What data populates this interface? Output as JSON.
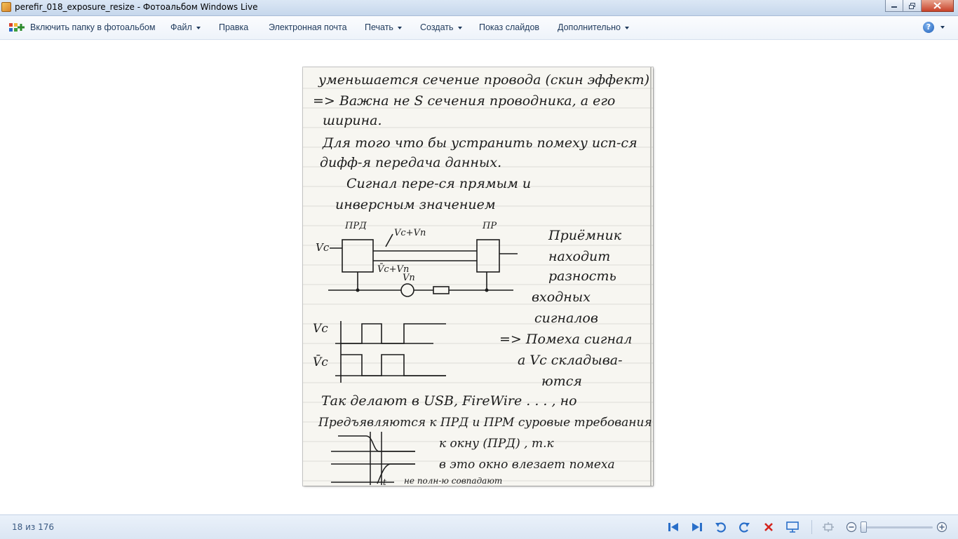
{
  "window": {
    "title": "perefir_018_exposure_resize - Фотоальбом Windows Live"
  },
  "menubar": {
    "items": [
      {
        "label": "Включить папку в фотоальбом",
        "has_dropdown": false
      },
      {
        "label": "Файл",
        "has_dropdown": true
      },
      {
        "label": "Правка",
        "has_dropdown": false
      },
      {
        "label": "Электронная почта",
        "has_dropdown": false
      },
      {
        "label": "Печать",
        "has_dropdown": true
      },
      {
        "label": "Создать",
        "has_dropdown": true
      },
      {
        "label": "Показ слайдов",
        "has_dropdown": false
      },
      {
        "label": "Дополнительно",
        "has_dropdown": true
      }
    ],
    "help_icon": "help-icon"
  },
  "photo": {
    "lines": [
      "уменьшается сечение провода (скин эффект)",
      "=> Важна не S сечения проводника, а его",
      "ширина.",
      "Для того что бы устранить помеху исп-ся",
      "дифф-я передача данных.",
      "Сигнал пере-ся прямым и",
      "инверсным значением",
      "Так делают в USB, FireWire . . . , но",
      "Предъявляются к ПРД и ПРМ суровые требования",
      "к окну (ПРД) , т.к",
      "в это окно влезает помеха",
      "не полн-ю совпадают"
    ],
    "side_note": [
      "Приёмник",
      "находит",
      "разность",
      "входных",
      "сигналов",
      "=> Помеха сигнал",
      "а Vc складыва-",
      "ются"
    ],
    "diagram_labels": {
      "tx": "ПРД",
      "rx": "ПР",
      "vc": "Vc",
      "vc_vn_top": "Vc+Vп",
      "vc_vn_bottom": "V̄c+Vп",
      "vn": "Vп",
      "wave_top": "Vc",
      "wave_bottom": "V̄c",
      "t": "t"
    }
  },
  "statusbar": {
    "counter": "18 из 176",
    "controls": [
      "previous-icon",
      "next-icon",
      "rotate-left-icon",
      "rotate-right-icon",
      "delete-icon",
      "slideshow-icon",
      "fit-icon",
      "zoom-out-icon",
      "zoom-in-icon"
    ],
    "zoom_level": 0.04
  }
}
